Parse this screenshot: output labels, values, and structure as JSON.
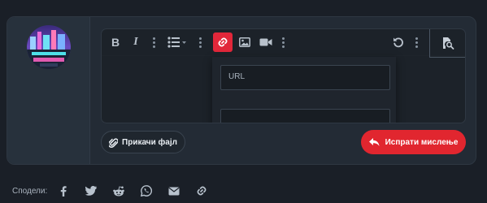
{
  "editor": {
    "toolbar": {
      "bold": "B",
      "italic": "I",
      "icons": [
        "bold-icon",
        "italic-icon",
        "list-icon",
        "link-icon",
        "image-icon",
        "video-icon",
        "undo-icon",
        "preview-icon"
      ]
    },
    "link_popup": {
      "url_placeholder": "URL"
    }
  },
  "actions": {
    "attach_label": "Прикачи фајл",
    "submit_label": "Испрати мислење"
  },
  "share": {
    "label": "Сподели:",
    "networks": [
      "facebook",
      "twitter",
      "reddit",
      "whatsapp",
      "email",
      "link"
    ]
  },
  "colors": {
    "background": "#1a1f27",
    "card": "#232b35",
    "accent": "#e1262f",
    "text": "#e8edf2"
  }
}
